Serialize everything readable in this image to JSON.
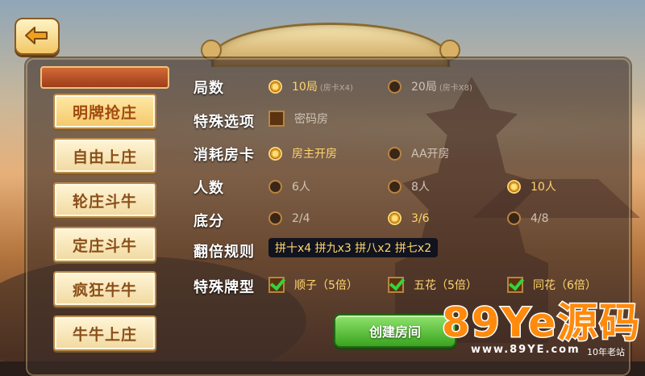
{
  "back": {
    "icon": "back-arrow-icon"
  },
  "sidebar": {
    "items": [
      {
        "label": "明牌抢庄",
        "active": true
      },
      {
        "label": "自由上庄"
      },
      {
        "label": "轮庄斗牛"
      },
      {
        "label": "定庄斗牛"
      },
      {
        "label": "疯狂牛牛"
      },
      {
        "label": "牛牛上庄"
      }
    ]
  },
  "options": {
    "rounds": {
      "label": "局数",
      "choices": [
        {
          "text": "10局",
          "sub": "(房卡X4)",
          "selected": true
        },
        {
          "text": "20局",
          "sub": "(房卡X8)",
          "selected": false
        }
      ]
    },
    "special": {
      "label": "特殊选项",
      "password_room": {
        "text": "密码房",
        "checked": false
      }
    },
    "room_card": {
      "label": "消耗房卡",
      "choices": [
        {
          "text": "房主开房",
          "selected": true
        },
        {
          "text": "AA开房",
          "selected": false
        }
      ]
    },
    "players": {
      "label": "人数",
      "choices": [
        {
          "text": "6人",
          "selected": false
        },
        {
          "text": "8人",
          "selected": false
        },
        {
          "text": "10人",
          "selected": true
        }
      ]
    },
    "base_score": {
      "label": "底分",
      "choices": [
        {
          "text": "2/4",
          "selected": false
        },
        {
          "text": "3/6",
          "selected": true
        },
        {
          "text": "4/8",
          "selected": false
        }
      ]
    },
    "multiplier": {
      "label": "翻倍规则",
      "value": "拼十x4 拼九x3 拼八x2 拼七x2"
    },
    "special_cards": {
      "label": "特殊牌型",
      "choices": [
        {
          "text": "顺子（5倍）",
          "checked": true
        },
        {
          "text": "五花（5倍）",
          "checked": true
        },
        {
          "text": "同花（6倍）",
          "checked": true
        }
      ]
    }
  },
  "create_button": {
    "label": "创建房间"
  },
  "watermark": {
    "main": "89Ye源码",
    "url": "www.89YE.com",
    "tag": "10年老站"
  },
  "colors": {
    "accent": "#ffd56b",
    "button_green": "#3aa41f",
    "watermark": "#ff8a0c"
  }
}
